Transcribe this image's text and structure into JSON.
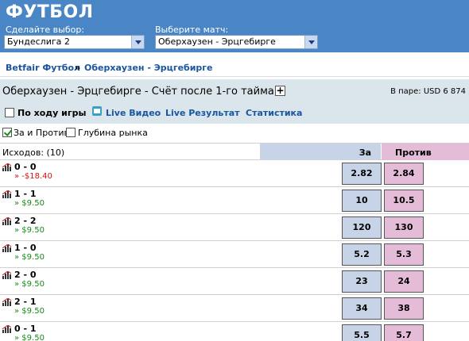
{
  "header": {
    "title": "ФУТБОЛ",
    "selection_label": "Сделайте выбор:",
    "selection_value": "Бундеслига 2",
    "match_label": "Выберите матч:",
    "match_value": "Оберхаузен - Эрцгебирге"
  },
  "breadcrumb": {
    "root": "Betfair Футбол",
    "separator": "»",
    "current": "Оберхаузен - Эрцгебирге"
  },
  "market": {
    "title": "Оберхаузен - Эрцгебирге - Счёт после 1-го тайма",
    "expand": "+",
    "matched": "В паре: USD 6 874",
    "inplay_label": "По ходу игры",
    "links": {
      "live_video": "Live Видео",
      "live_results": "Live Результат",
      "stats": "Статистика"
    },
    "options": {
      "back_lay": "За и Против",
      "depth": "Глубина рынка"
    }
  },
  "grid": {
    "outcomes_label": "Исходов:",
    "outcomes_count": "(10)",
    "back_header": "За",
    "lay_header": "Против",
    "colors": {
      "back": "#c7d3e6",
      "lay": "#e5bcd8"
    },
    "rows": [
      {
        "name": "0 - 0",
        "pl": "» -$18.40",
        "pl_sign": "neg",
        "back": "2.82",
        "lay": "2.84"
      },
      {
        "name": "1 - 1",
        "pl": "» $9.50",
        "pl_sign": "pos",
        "back": "10",
        "lay": "10.5"
      },
      {
        "name": "2 - 2",
        "pl": "» $9.50",
        "pl_sign": "pos",
        "back": "120",
        "lay": "130"
      },
      {
        "name": "1 - 0",
        "pl": "» $9.50",
        "pl_sign": "pos",
        "back": "5.2",
        "lay": "5.3"
      },
      {
        "name": "2 - 0",
        "pl": "» $9.50",
        "pl_sign": "pos",
        "back": "23",
        "lay": "24"
      },
      {
        "name": "2 - 1",
        "pl": "» $9.50",
        "pl_sign": "pos",
        "back": "34",
        "lay": "38"
      },
      {
        "name": "0 - 1",
        "pl": "» $9.50",
        "pl_sign": "pos",
        "back": "5.5",
        "lay": "5.7"
      }
    ]
  }
}
